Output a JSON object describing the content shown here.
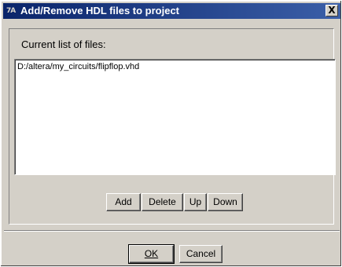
{
  "window": {
    "icon_label": "7A",
    "title": "Add/Remove HDL files to project",
    "close_label": "X"
  },
  "group": {
    "label": "Current list of files:"
  },
  "files": [
    "D:/altera/my_circuits/flipflop.vhd"
  ],
  "buttons": {
    "add": "Add",
    "delete": "Delete",
    "up": "Up",
    "down": "Down",
    "ok": "OK",
    "cancel": "Cancel"
  }
}
